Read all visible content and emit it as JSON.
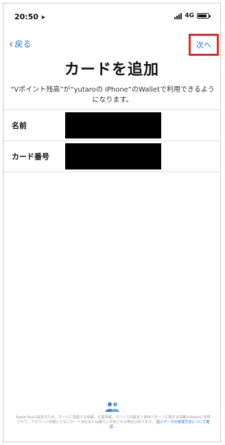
{
  "status_bar": {
    "time": "20:50",
    "network": "4G"
  },
  "nav": {
    "back_label": "戻る",
    "next_label": "次へ"
  },
  "header": {
    "title": "カードを追加",
    "description": "“Vポイント残高”が“yutaroの iPhone”のWalletで利用できるようになります。"
  },
  "form": {
    "fields": [
      {
        "label": "名前"
      },
      {
        "label": "カード番号"
      }
    ]
  },
  "footer": {
    "icon": "people-icon",
    "text": "Apple Payの設定のため、カードに関連する情報、位置情報、デバイスの設定と使用パターンに関する情報がAppleに送信されて、アカウント情報とともにカード会社または銀行と共有される場合があります。",
    "link_text": "個人データの管理方法について確認..."
  },
  "colors": {
    "link": "#1a73e8",
    "highlight_border": "#d92b2b"
  }
}
